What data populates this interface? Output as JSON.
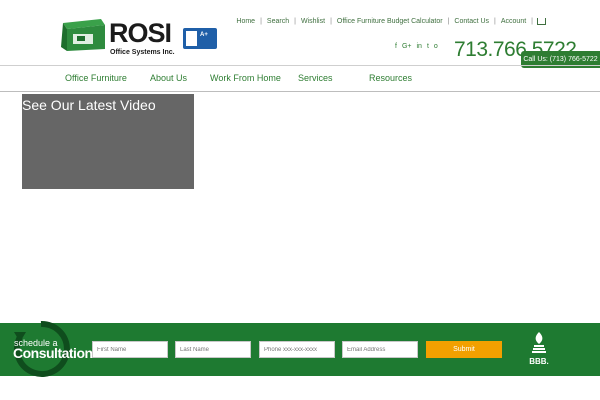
{
  "brand": {
    "logo_word": "ROSI",
    "logo_subtitle": "Office Systems Inc.",
    "accent_color": "#2e7d32"
  },
  "top_links": [
    "Home",
    "Search",
    "Wishlist",
    "Office Furniture Budget Calculator",
    "Contact Us",
    "Account"
  ],
  "social_icons": [
    "facebook-icon",
    "google-plus-icon",
    "linkedin-icon",
    "twitter-icon",
    "instagram-icon"
  ],
  "social_glyphs": [
    "f",
    "G+",
    "in",
    "t",
    "o"
  ],
  "phone": "713.766.5722",
  "call_tab": "Call Us: (713) 766-5722",
  "nav": [
    "Office Furniture",
    "About Us",
    "Work From Home",
    "Services",
    "Resources"
  ],
  "video": {
    "title": "See Our Latest Video"
  },
  "consultation": {
    "small": "schedule a",
    "big": "Consultation",
    "fields": {
      "first_name": "First Name",
      "last_name": "Last Name",
      "phone": "Phone xxx-xxx-xxxx",
      "email": "Email Address"
    },
    "submit": "Submit",
    "band_color": "#1e7a31",
    "button_color": "#f2a000"
  },
  "bbb_footer_label": "BBB."
}
